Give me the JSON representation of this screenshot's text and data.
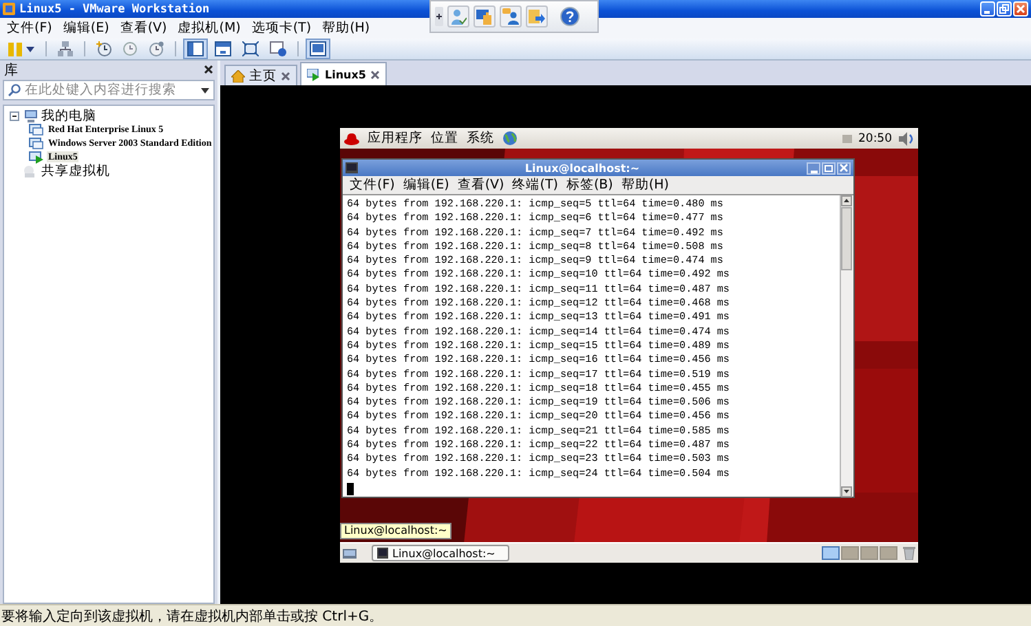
{
  "window": {
    "title": "Linux5 - VMware Workstation"
  },
  "menu": [
    "文件(F)",
    "编辑(E)",
    "查看(V)",
    "虚拟机(M)",
    "选项卡(T)",
    "帮助(H)"
  ],
  "library": {
    "title": "库",
    "search": {
      "placeholder": "在此处键入内容进行搜索"
    },
    "tree": [
      {
        "label": "我的电脑",
        "kind": "computer",
        "expanded": true,
        "selected": false,
        "children": [
          {
            "label": "Red Hat Enterprise Linux 5",
            "kind": "vm",
            "running": false,
            "selected": false
          },
          {
            "label": "Windows Server 2003 Standard Edition",
            "kind": "vm",
            "running": false,
            "selected": false
          },
          {
            "label": "Linux5",
            "kind": "vm",
            "running": true,
            "selected": true
          }
        ]
      },
      {
        "label": "共享虚拟机",
        "kind": "shared",
        "selected": false
      }
    ]
  },
  "tabs": [
    {
      "label": "主页",
      "kind": "home",
      "selected": false
    },
    {
      "label": "Linux5",
      "kind": "vm",
      "selected": true
    }
  ],
  "guest": {
    "panel": {
      "menus": [
        "应用程序",
        "位置",
        "系统"
      ],
      "clock": "20:50"
    },
    "terminal": {
      "title": "Linux@localhost:~",
      "menu": [
        "文件(F)",
        "编辑(E)",
        "查看(V)",
        "终端(T)",
        "标签(B)",
        "帮助(H)"
      ],
      "lines": [
        "64 bytes from 192.168.220.1: icmp_seq=5 ttl=64 time=0.480 ms",
        "64 bytes from 192.168.220.1: icmp_seq=6 ttl=64 time=0.477 ms",
        "64 bytes from 192.168.220.1: icmp_seq=7 ttl=64 time=0.492 ms",
        "64 bytes from 192.168.220.1: icmp_seq=8 ttl=64 time=0.508 ms",
        "64 bytes from 192.168.220.1: icmp_seq=9 ttl=64 time=0.474 ms",
        "64 bytes from 192.168.220.1: icmp_seq=10 ttl=64 time=0.492 ms",
        "64 bytes from 192.168.220.1: icmp_seq=11 ttl=64 time=0.487 ms",
        "64 bytes from 192.168.220.1: icmp_seq=12 ttl=64 time=0.468 ms",
        "64 bytes from 192.168.220.1: icmp_seq=13 ttl=64 time=0.491 ms",
        "64 bytes from 192.168.220.1: icmp_seq=14 ttl=64 time=0.474 ms",
        "64 bytes from 192.168.220.1: icmp_seq=15 ttl=64 time=0.489 ms",
        "64 bytes from 192.168.220.1: icmp_seq=16 ttl=64 time=0.456 ms",
        "64 bytes from 192.168.220.1: icmp_seq=17 ttl=64 time=0.519 ms",
        "64 bytes from 192.168.220.1: icmp_seq=18 ttl=64 time=0.455 ms",
        "64 bytes from 192.168.220.1: icmp_seq=19 ttl=64 time=0.506 ms",
        "64 bytes from 192.168.220.1: icmp_seq=20 ttl=64 time=0.456 ms",
        "64 bytes from 192.168.220.1: icmp_seq=21 ttl=64 time=0.585 ms",
        "64 bytes from 192.168.220.1: icmp_seq=22 ttl=64 time=0.487 ms",
        "64 bytes from 192.168.220.1: icmp_seq=23 ttl=64 time=0.503 ms",
        "64 bytes from 192.168.220.1: icmp_seq=24 ttl=64 time=0.504 ms"
      ]
    },
    "tooltip": "Linux@localhost:~",
    "taskbar": [
      {
        "label": "Linux@localhost:~"
      }
    ],
    "workspaces": [
      {
        "selected": true
      },
      {
        "selected": false
      },
      {
        "selected": false
      },
      {
        "selected": false
      }
    ]
  },
  "status_bar": "要将输入定向到该虚拟机，请在虚拟机内部单击或按 Ctrl+G。"
}
